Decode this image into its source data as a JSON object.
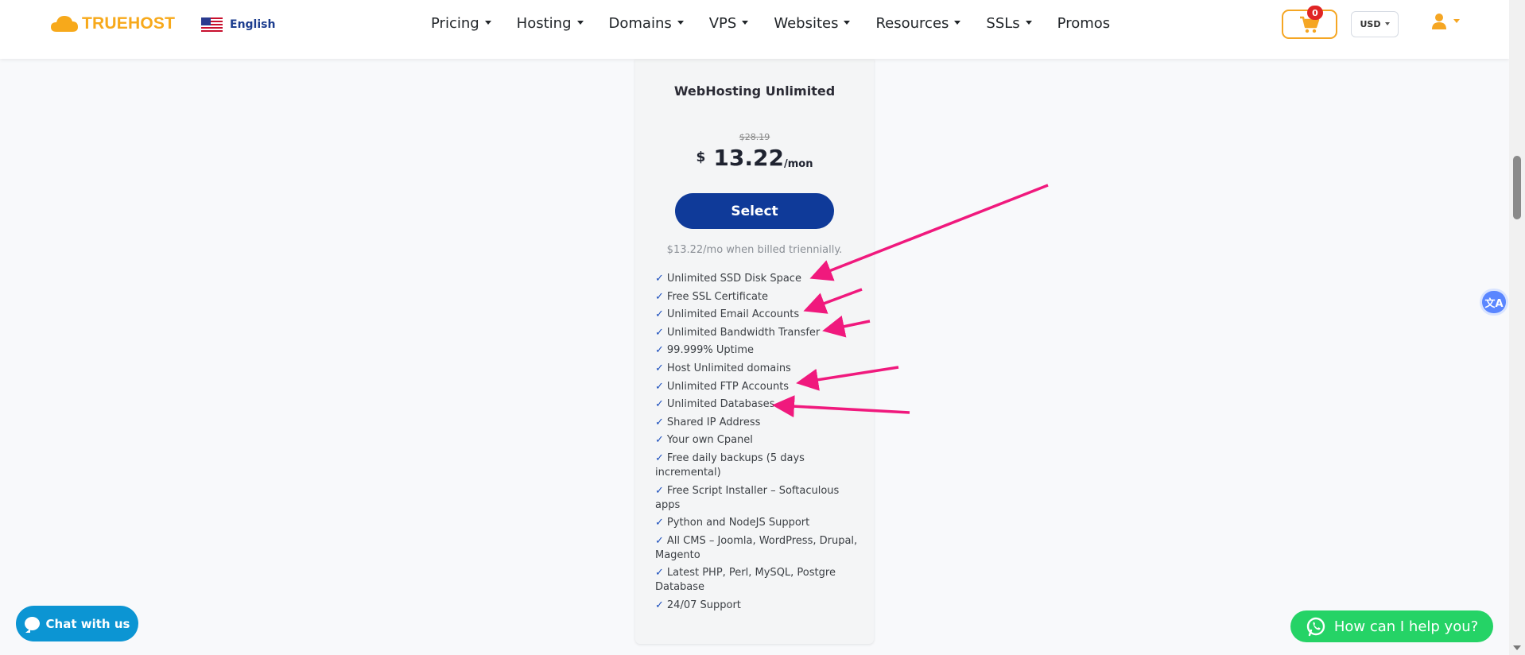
{
  "header": {
    "logo_text": "TRUEHOST",
    "language": "English",
    "nav": [
      {
        "label": "Pricing",
        "has_dropdown": true
      },
      {
        "label": "Hosting",
        "has_dropdown": true
      },
      {
        "label": "Domains",
        "has_dropdown": true
      },
      {
        "label": "VPS",
        "has_dropdown": true
      },
      {
        "label": "Websites",
        "has_dropdown": true
      },
      {
        "label": "Resources",
        "has_dropdown": true
      },
      {
        "label": "SSLs",
        "has_dropdown": true
      },
      {
        "label": "Promos",
        "has_dropdown": false
      }
    ],
    "cart_count": "0",
    "currency": "USD"
  },
  "plan": {
    "title": "WebHosting Unlimited",
    "old_price": "$28.19",
    "currency_symbol": "$",
    "price": "13.22",
    "per": "/mon",
    "select_label": "Select",
    "billing_note": "$13.22/mo when billed triennially.",
    "tick": "✓",
    "features": [
      "Unlimited SSD Disk Space",
      "Free SSL Certificate",
      "Unlimited Email Accounts",
      "Unlimited Bandwidth Transfer",
      "99.999% Uptime",
      "Host Unlimited domains",
      "Unlimited FTP Accounts",
      "Unlimited Databases",
      "Shared IP Address",
      "Your own Cpanel",
      "Free daily backups (5 days incremental)",
      "Free Script Installer – Softaculous apps",
      "Python and NodeJS Support",
      "All CMS – Joomla, WordPress, Drupal, Magento",
      "Latest PHP, Perl, MySQL, Postgre Database",
      "24/07 Support"
    ]
  },
  "widgets": {
    "chat_label": "Chat with us",
    "whatsapp_label": "How can I help you?"
  },
  "colors": {
    "brand_orange": "#f7a91b",
    "select_blue": "#0f3a99",
    "annotation_pink": "#f0197d",
    "chat_blue": "#0c95d3",
    "whatsapp_green": "#25d366"
  },
  "icons": {
    "logo": "cloud-icon",
    "language": "us-flag-icon",
    "cart": "shopping-cart-icon",
    "account": "user-icon",
    "translate": "translate-icon",
    "chat": "chat-bubble-icon",
    "whatsapp": "whatsapp-icon"
  }
}
